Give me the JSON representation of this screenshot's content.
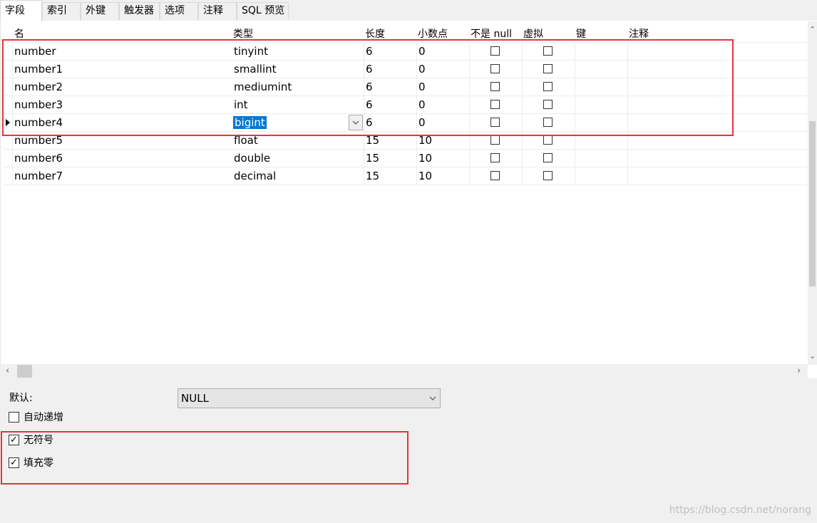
{
  "tabs": [
    {
      "label": "字段",
      "active": true
    },
    {
      "label": "索引"
    },
    {
      "label": "外键"
    },
    {
      "label": "触发器"
    },
    {
      "label": "选项"
    },
    {
      "label": "注释"
    },
    {
      "label": "SQL 预览"
    }
  ],
  "columns": [
    "名",
    "类型",
    "长度",
    "小数点",
    "不是 null",
    "虚拟",
    "键",
    "注释"
  ],
  "rows": [
    {
      "name": "number",
      "type": "tinyint",
      "length": "6",
      "decimals": "0",
      "not_null": false,
      "virtual": false
    },
    {
      "name": "number1",
      "type": "smallint",
      "length": "6",
      "decimals": "0",
      "not_null": false,
      "virtual": false
    },
    {
      "name": "number2",
      "type": "mediumint",
      "length": "6",
      "decimals": "0",
      "not_null": false,
      "virtual": false
    },
    {
      "name": "number3",
      "type": "int",
      "length": "6",
      "decimals": "0",
      "not_null": false,
      "virtual": false
    },
    {
      "name": "number4",
      "type": "bigint",
      "length": "6",
      "decimals": "0",
      "not_null": false,
      "virtual": false,
      "selected": true
    },
    {
      "name": "number5",
      "type": "float",
      "length": "15",
      "decimals": "10",
      "not_null": false,
      "virtual": false
    },
    {
      "name": "number6",
      "type": "double",
      "length": "15",
      "decimals": "10",
      "not_null": false,
      "virtual": false
    },
    {
      "name": "number7",
      "type": "decimal",
      "length": "15",
      "decimals": "10",
      "not_null": false,
      "virtual": false
    }
  ],
  "panel": {
    "default_label": "默认:",
    "default_value": "NULL",
    "auto_increment": {
      "label": "自动递增",
      "checked": false
    },
    "unsigned": {
      "label": "无符号",
      "checked": true
    },
    "zerofill": {
      "label": "填充零",
      "checked": true
    }
  },
  "watermark": "https://blog.csdn.net/norang",
  "colors": {
    "highlight": "#e8333c",
    "selection": "#0078d7"
  }
}
